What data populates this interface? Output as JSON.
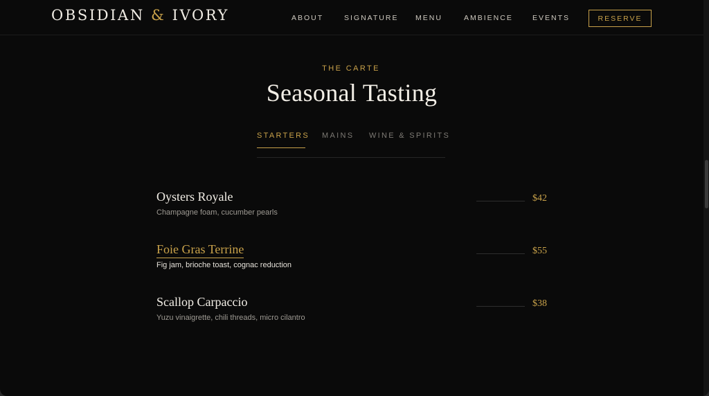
{
  "brand": {
    "name_left": "OBSIDIAN",
    "ampersand": "&",
    "name_right": "IVORY"
  },
  "nav": {
    "links": [
      "ABOUT",
      "SIGNATURE",
      "MENU",
      "AMBIENCE",
      "EVENTS"
    ],
    "reserve_label": "RESERVE"
  },
  "section": {
    "eyebrow": "THE CARTE",
    "title": "Seasonal Tasting"
  },
  "tabs": {
    "items": [
      "STARTERS",
      "MAINS",
      "WINE & SPIRITS"
    ],
    "active": "STARTERS"
  },
  "menu": {
    "items": [
      {
        "name": "Oysters Royale",
        "description": "Champagne foam, cucumber pearls",
        "price": "$42"
      },
      {
        "name": "Foie Gras Terrine",
        "description": "Fig jam, brioche toast, cognac reduction",
        "price": "$55"
      },
      {
        "name": "Scallop Carpaccio",
        "description": "Yuzu vinaigrette, chili threads, micro cilantro",
        "price": "$38"
      }
    ]
  },
  "colors": {
    "background": "#0a0a0a",
    "accent_gold": "#c9a24a",
    "text_primary": "#f2eee6",
    "text_muted": "#9e9a93"
  }
}
